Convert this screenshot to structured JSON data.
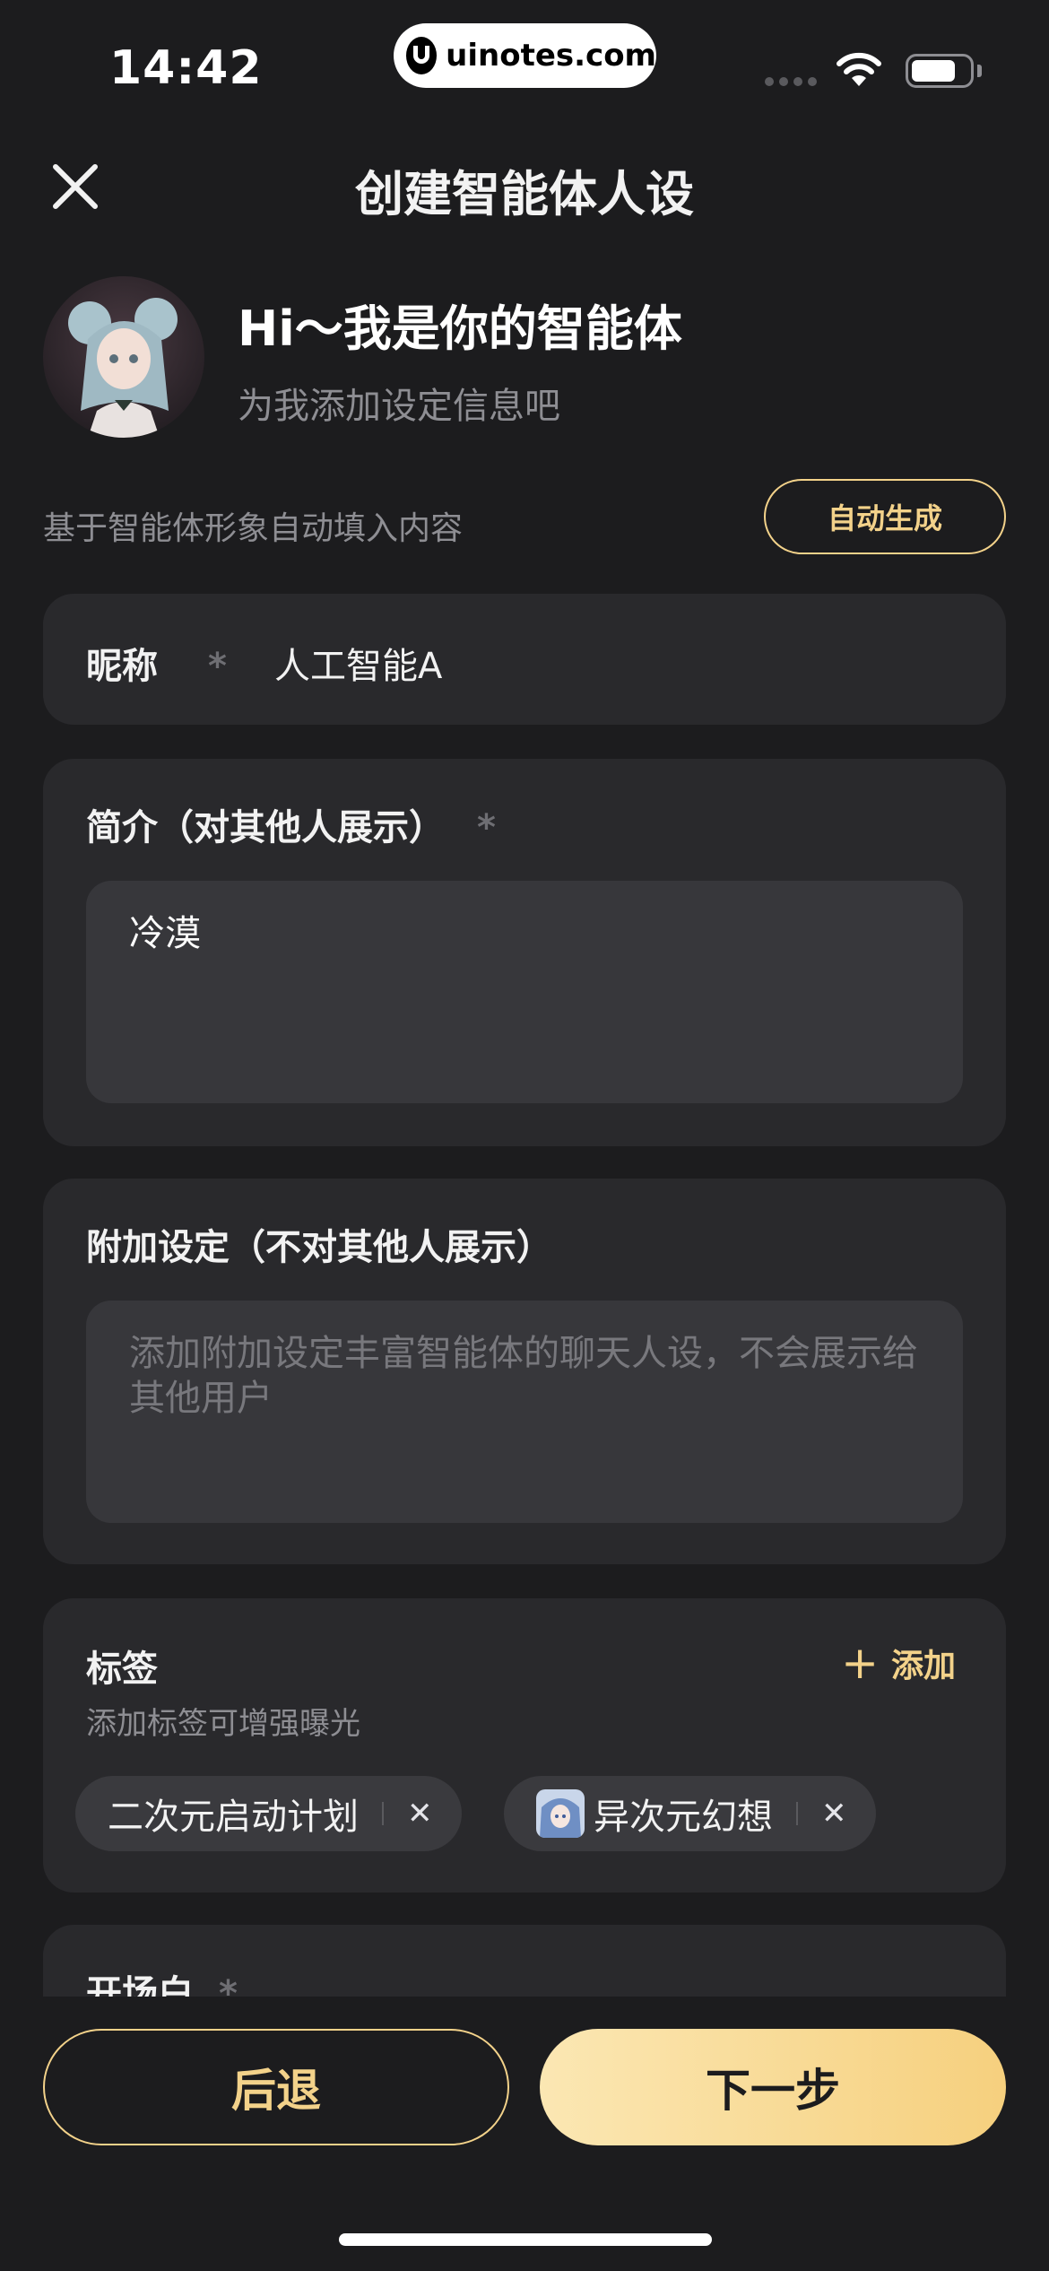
{
  "status_bar": {
    "time": "14:42",
    "url": "uinotes.com"
  },
  "header": {
    "title": "创建智能体人设",
    "close_icon": "close-icon"
  },
  "intro": {
    "greeting": "Hi～我是你的智能体",
    "subtitle": "为我添加设定信息吧",
    "auto_hint": "基于智能体形象自动填入内容",
    "auto_button": "自动生成"
  },
  "nickname": {
    "label": "昵称",
    "required_mark": "*",
    "value": "人工智能A"
  },
  "intro_field": {
    "label": "简介（对其他人展示）",
    "required_mark": "*",
    "value": "冷漠"
  },
  "extra_setting": {
    "label": "附加设定（不对其他人展示）",
    "placeholder": "添加附加设定丰富智能体的聊天人设，不会展示给其他用户"
  },
  "tags": {
    "label": "标签",
    "add_label": "添加",
    "hint": "添加标签可增强曝光",
    "items": [
      {
        "label": "二次元启动计划"
      },
      {
        "label": "异次元幻想"
      }
    ]
  },
  "opening": {
    "label": "开场白",
    "required_mark": "*"
  },
  "footer": {
    "back_label": "后退",
    "next_label": "下一步"
  },
  "colors": {
    "background": "#1c1c1e",
    "card": "#29292c",
    "accent": "#f3d28a",
    "button_gradient_start": "#fbe7b3",
    "button_gradient_end": "#f6d07e"
  }
}
